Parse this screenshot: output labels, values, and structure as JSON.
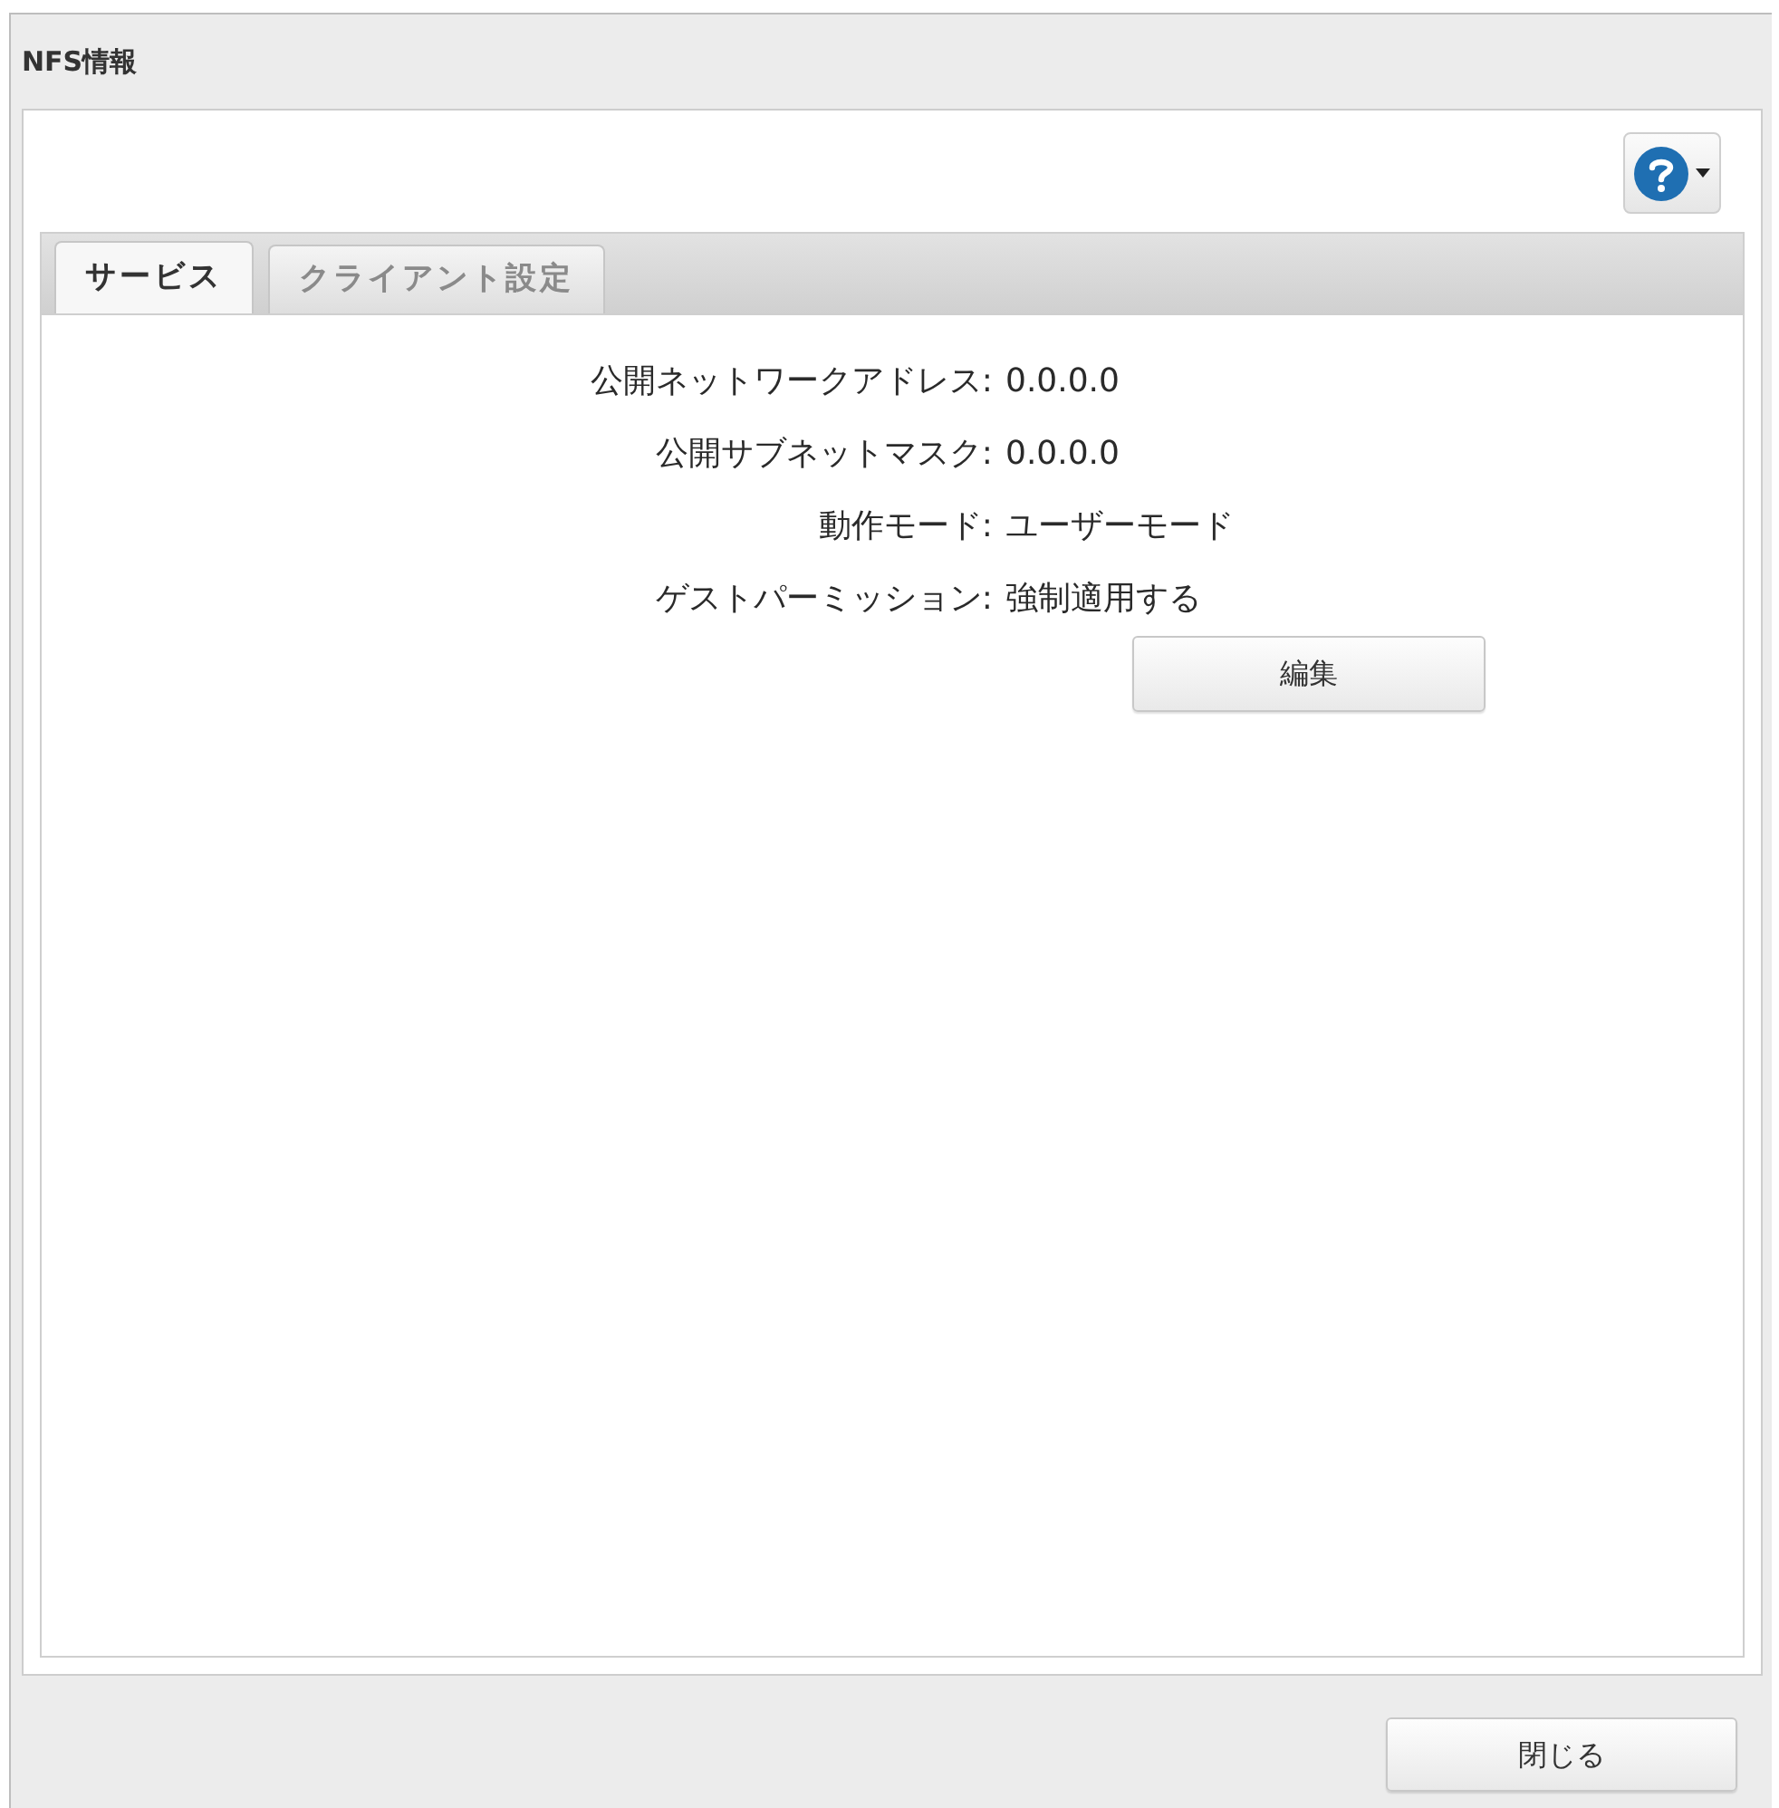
{
  "window": {
    "title": "NFS情報"
  },
  "tabs": [
    {
      "label": "サービス",
      "selected": true
    },
    {
      "label": "クライアント設定",
      "selected": false
    }
  ],
  "fields": [
    {
      "label": "公開ネットワークアドレス:",
      "value": "0.0.0.0"
    },
    {
      "label": "公開サブネットマスク:",
      "value": "0.0.0.0"
    },
    {
      "label": "動作モード:",
      "value": "ユーザーモード"
    },
    {
      "label": "ゲストパーミッション:",
      "value": "強制適用する"
    }
  ],
  "edit_button": {
    "label": "編集"
  },
  "close_button": {
    "label": "閉じる"
  }
}
